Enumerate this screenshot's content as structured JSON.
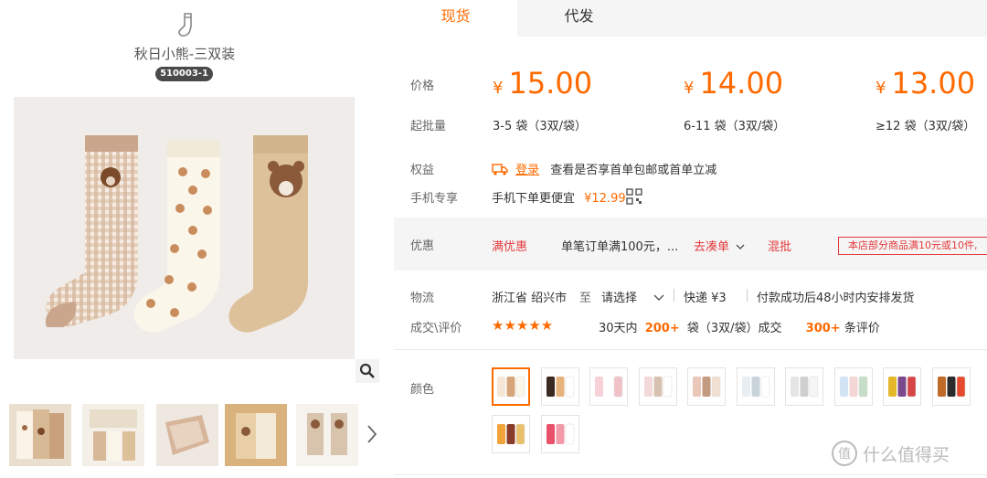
{
  "product": {
    "name": "秋日小熊-三双装",
    "sku": "510003-1"
  },
  "tabs": [
    {
      "label": "现货",
      "active": true
    },
    {
      "label": "代发",
      "active": false
    }
  ],
  "pricing": {
    "label": "价格",
    "currency": "¥",
    "tiers": [
      {
        "price": "15.00",
        "qty": "3-5 袋（3双/袋）"
      },
      {
        "price": "14.00",
        "qty": "6-11 袋（3双/袋）"
      },
      {
        "price": "13.00",
        "qty": "≥12 袋（3双/袋）"
      }
    ],
    "qty_label": "起批量"
  },
  "rights": {
    "label": "权益",
    "login": "登录",
    "text": "查看是否享首单包邮或首单立减"
  },
  "mobile": {
    "label": "手机专享",
    "text": "手机下单更便宜",
    "price": "¥12.99"
  },
  "promo": {
    "label": "优惠",
    "tag": "满优惠",
    "desc": "单笔订单满100元，...",
    "link": "去凑单",
    "mix": "混批",
    "note": "本店部分商品满10元或10件,"
  },
  "logistics": {
    "label": "物流",
    "from": "浙江省 绍兴市",
    "to_label": "至",
    "select": "请选择",
    "express": "快递 ¥3",
    "ship": "付款成功后48小时内安排发货"
  },
  "deals": {
    "label": "成交\\评价",
    "stars": "★★★★★",
    "rating": 4.5,
    "days_prefix": "30天内",
    "sold": "200+",
    "sold_suffix": "袋（3双/袋）成交",
    "reviews": "300+",
    "reviews_suffix": "条评价"
  },
  "colors": {
    "label": "颜色",
    "selected_index": 0,
    "count": 12
  },
  "watermark": {
    "icon": "值",
    "text": "什么值得买"
  },
  "accent": "#ff6a00"
}
